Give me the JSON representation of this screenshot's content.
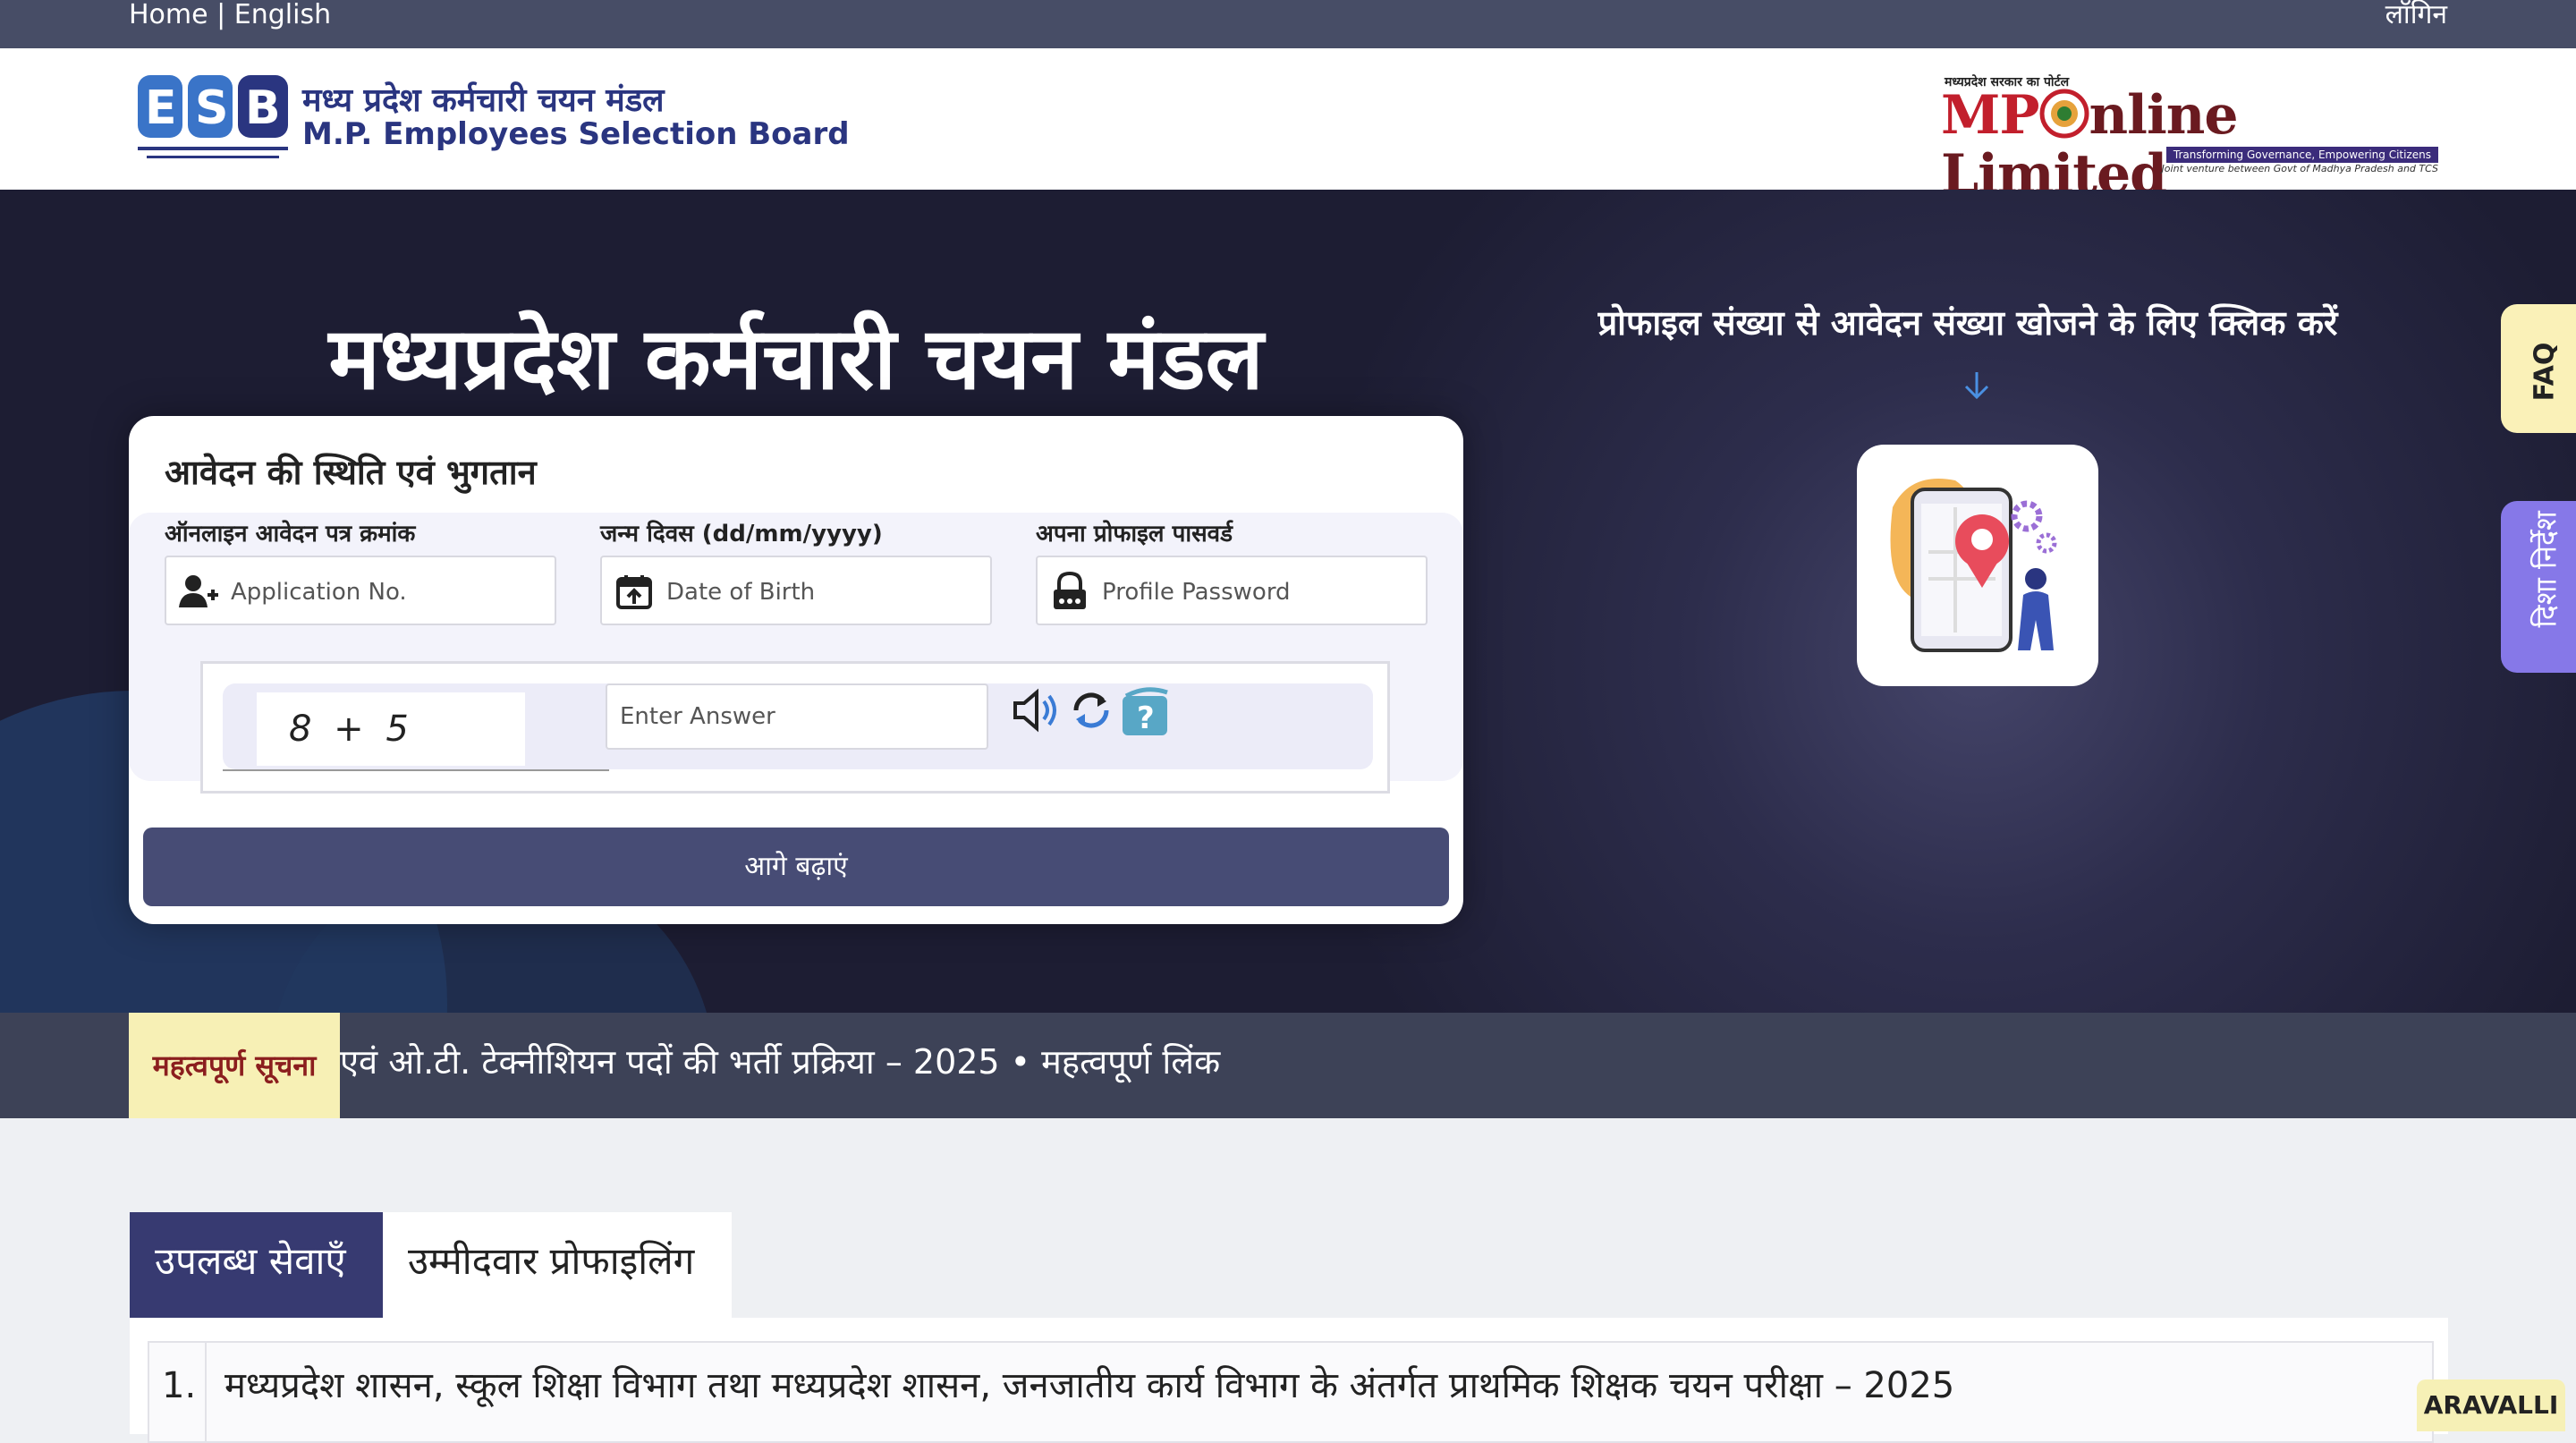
{
  "topbar": {
    "home": "Home",
    "separator": "|",
    "language": "English",
    "login": "लॉगिन"
  },
  "header": {
    "esb_name_hi": "मध्य प्रदेश कर्मचारी चयन मंडल",
    "esb_name_en": "M.P. Employees Selection Board",
    "mp_tagline": "मध्यप्रदेश सरकार का पोर्टल",
    "mp_name_mp": "MP",
    "mp_name_rest": "nline Limited",
    "mp_sub1": "Transforming Governance, Empowering Citizens",
    "mp_sub2": "Joint venture between Govt of Madhya Pradesh and TCS"
  },
  "hero": {
    "title": "मध्यप्रदेश कर्मचारी चयन मंडल",
    "profile_hint": "प्रोफाइल संख्या से आवेदन संख्या खोजने के लिए क्लिक करें"
  },
  "form": {
    "heading": "आवेदन की स्थिति एवं भुगतान",
    "application": {
      "label": "ऑनलाइन आवेदन पत्र क्रमांक",
      "placeholder": "Application No."
    },
    "dob": {
      "label": "जन्म दिवस (dd/mm/yyyy)",
      "placeholder": "Date of Birth"
    },
    "password": {
      "label": "अपना प्रोफाइल पासवर्ड",
      "placeholder": "Profile Password"
    },
    "captcha": {
      "expression": "8 + 5",
      "placeholder": "Enter Answer"
    },
    "submit": "आगे बढ़ाएं"
  },
  "side": {
    "faq": "FAQ",
    "guide": "दिशा निर्देश"
  },
  "notice": {
    "label": "महत्वपूर्ण सूचना",
    "text": "एवं ओ.टी. टेक्नीशियन पदों की भर्ती प्रक्रिया – 2025 • महत्वपूर्ण लिंक"
  },
  "tabs": [
    {
      "label": "उपलब्ध सेवाएँ"
    },
    {
      "label": "उम्मीदवार प्रोफाइलिंग"
    }
  ],
  "services": [
    {
      "num": "1.",
      "text": "मध्यप्रदेश शासन, स्कूल शिक्षा विभाग तथा मध्यप्रदेश शासन, जनजातीय कार्य विभाग के अंतर्गत प्राथमिक शिक्षक चयन परीक्षा – 2025"
    }
  ],
  "badge": "ARAVALLI",
  "colors": {
    "topbar": "#474d66",
    "hero_dark": "#1d1d33",
    "button": "#474c75",
    "tab_active": "#373a71",
    "faq": "#faf1b8",
    "guide": "#8678e8",
    "notice_label": "#f7f0b5"
  }
}
